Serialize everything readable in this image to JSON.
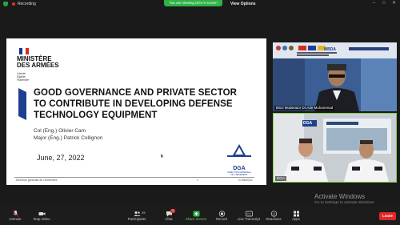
{
  "topbar": {
    "recording_label": "Recording",
    "share_banner": "You are viewing DGA's screen",
    "view_options_label": "View Options",
    "window_controls": [
      "–",
      "□",
      "✕"
    ]
  },
  "slide": {
    "ministry_line1": "MINISTÈRE",
    "ministry_line2": "DES ARMÉES",
    "motto": [
      "Liberté",
      "Égalité",
      "Fraternité"
    ],
    "title_lines": [
      "GOOD GOVERNANCE AND PRIVATE SECTOR",
      "TO CONTRIBUTE IN DEVELOPING DEFENSE",
      "TECHNOLOGY EQUIPMENT"
    ],
    "presenters": [
      "Col (Eng.) Olivier Cam",
      "Major (Eng.) Patrick Collignon"
    ],
    "date": "June, 27, 2022",
    "logo_text": "DGA",
    "logo_subtext": [
      "DIRECTION GÉNÉRALE",
      "DE L'ARMEMENT"
    ],
    "footer_left": "Direction générale de l'armement",
    "footer_page": "1",
    "footer_date": "27/06/2022",
    "flag_colors": [
      "#0a3a8c",
      "#ffffff",
      "#d52b1e"
    ]
  },
  "participants": [
    {
      "label": "BSIJ Moderator Dr.Ade Muhammad"
    },
    {
      "label": "DGA"
    }
  ],
  "tile_banner": "MBDA",
  "windows_notice": {
    "title": "Activate Windows",
    "subtitle": "Go to Settings to activate Windows."
  },
  "toolbar": {
    "unmute_label": "Unmute",
    "stop_video_label": "Stop Video",
    "participants_label": "Participants",
    "participants_count": "29",
    "chat_label": "Chat",
    "chat_badge": "2",
    "share_label": "Share Screen",
    "record_label": "Record",
    "live_transcript_label": "Live Transcript",
    "reactions_label": "Reactions",
    "apps_label": "Apps",
    "end_label": "Leave"
  }
}
